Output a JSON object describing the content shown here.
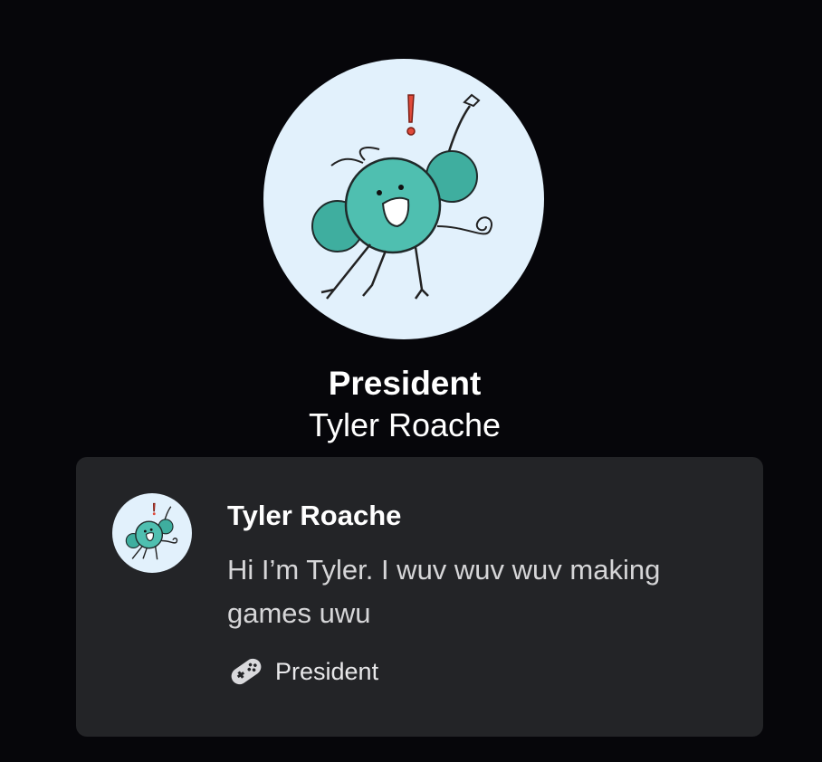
{
  "profile": {
    "role_title": "President",
    "name": "Tyler Roache",
    "avatar_icon": "teal-mouse-mascot-avatar"
  },
  "card": {
    "name": "Tyler Roache",
    "bio": "Hi I’m Tyler. I wuv wuv wuv making games uwu",
    "role_label": "President",
    "role_icon": "gamepad-icon"
  },
  "colors": {
    "background": "#06060a",
    "card_background": "#232427",
    "avatar_background": "#e2f1fc",
    "mascot_teal": "#4fbfb0"
  }
}
